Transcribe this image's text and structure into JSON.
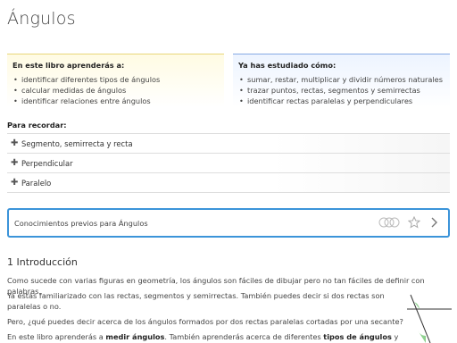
{
  "page": {
    "title": "Ángulos"
  },
  "learn_box": {
    "heading": "En este libro aprenderás a:",
    "items": [
      "identificar diferentes tipos de ángulos",
      "calcular medidas de ángulos",
      "identificar relaciones entre ángulos"
    ]
  },
  "studied_box": {
    "heading": "Ya has estudiado cómo:",
    "items": [
      "sumar, restar, multiplicar y dividir números naturales",
      "trazar puntos, rectas, segmentos y semirrectas",
      "identificar rectas paralelas y perpendiculares"
    ]
  },
  "recall": {
    "heading": "Para recordar:",
    "items": [
      {
        "label": "Segmento, semirrecta y recta",
        "icon": "plus-icon"
      },
      {
        "label": "Perpendicular",
        "icon": "plus-icon"
      },
      {
        "label": "Paralelo",
        "icon": "plus-icon"
      }
    ]
  },
  "prior_knowledge": {
    "label": "Conocimientos previos para Ángulos",
    "icons": [
      "progress-circles-icon",
      "star-icon",
      "chevron-right-icon"
    ]
  },
  "intro": {
    "title": "1 Introducción",
    "p1": "Como sucede con varias figuras en geometría, los ángulos son fáciles de dibujar pero no tan fáciles de definir con palabras.",
    "p2_line1": "Ya estás familiarizado con las rectas, segmentos y semirrectas. También puedes decir si dos rectas son",
    "p2_line2": "paralelas o no.",
    "p3": "Pero, ¿qué puedes decir acerca de los ángulos formados por dos rectas paralelas cortadas por una secante?",
    "p4_before": "En este libro aprenderás a ",
    "p4_bold1": "medir ángulos",
    "p4_middle": ". También aprenderás acerca de diferentes ",
    "p4_bold2": "tipos de ángulos",
    "p4_after": " y"
  },
  "colors": {
    "learn_border": "#e9d67a",
    "studied_border": "#86a9e4",
    "card_border": "#3b94d9",
    "figure_green": "#8fd18f"
  }
}
